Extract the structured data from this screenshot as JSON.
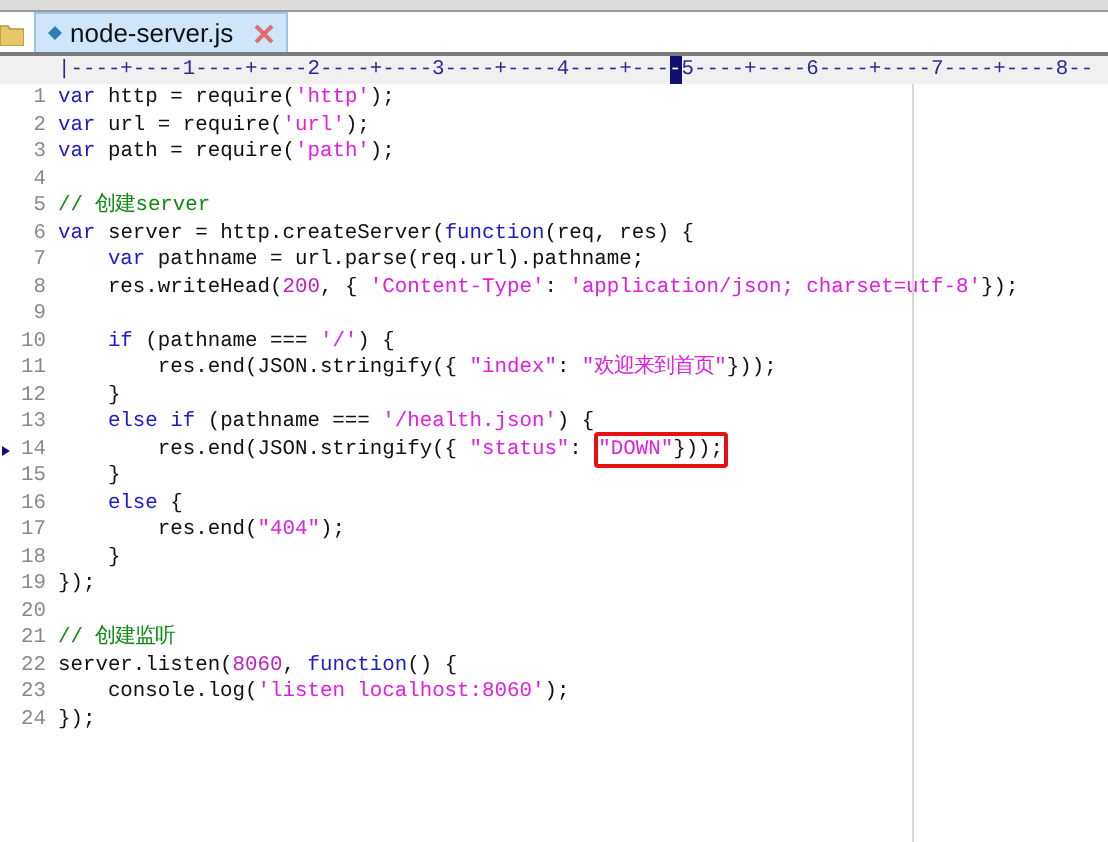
{
  "tabs": [
    {
      "label": "node-server.js",
      "selected": true
    }
  ],
  "ruler": [
    {
      "text": "|----+----1----+----2----+----3----+----4----+---",
      "selected": false
    },
    {
      "text": "-",
      "selected": true
    },
    {
      "text": "5----+----6----+----7----+----8--",
      "selected": false
    }
  ],
  "lines": [
    {
      "number": "1",
      "marked": false,
      "tokens": [
        {
          "kind": "kw",
          "text": "var"
        },
        {
          "kind": "plain",
          "text": " http = require("
        },
        {
          "kind": "str",
          "text": "'http'"
        },
        {
          "kind": "plain",
          "text": ");"
        }
      ]
    },
    {
      "number": "2",
      "marked": false,
      "tokens": [
        {
          "kind": "kw",
          "text": "var"
        },
        {
          "kind": "plain",
          "text": " url = require("
        },
        {
          "kind": "str",
          "text": "'url'"
        },
        {
          "kind": "plain",
          "text": ");"
        }
      ]
    },
    {
      "number": "3",
      "marked": false,
      "tokens": [
        {
          "kind": "kw",
          "text": "var"
        },
        {
          "kind": "plain",
          "text": " path = require("
        },
        {
          "kind": "str",
          "text": "'path'"
        },
        {
          "kind": "plain",
          "text": ");"
        }
      ]
    },
    {
      "number": "4",
      "marked": false
    },
    {
      "number": "5",
      "marked": false,
      "tokens": [
        {
          "kind": "cmt",
          "text": "// 创建server"
        }
      ]
    },
    {
      "number": "6",
      "marked": false,
      "tokens": [
        {
          "kind": "kw",
          "text": "var"
        },
        {
          "kind": "plain",
          "text": " server = http.createServer("
        },
        {
          "kind": "kw",
          "text": "function"
        },
        {
          "kind": "plain",
          "text": "(req, res) {"
        }
      ]
    },
    {
      "number": "7",
      "marked": false,
      "tokens": [
        {
          "kind": "kw",
          "text": "    var"
        },
        {
          "kind": "plain",
          "text": " pathname = url.parse(req.url).pathname;"
        }
      ]
    },
    {
      "number": "8",
      "marked": false,
      "tokens": [
        {
          "kind": "plain",
          "text": "    res.writeHead("
        },
        {
          "kind": "num",
          "text": "200"
        },
        {
          "kind": "plain",
          "text": ", { "
        },
        {
          "kind": "str",
          "text": "'Content-Type'"
        },
        {
          "kind": "plain",
          "text": ": "
        },
        {
          "kind": "str",
          "text": "'application/json; charset=utf-8'"
        },
        {
          "kind": "plain",
          "text": "});"
        }
      ]
    },
    {
      "number": "9",
      "marked": false
    },
    {
      "number": "10",
      "marked": false,
      "tokens": [
        {
          "kind": "kw",
          "text": "    if"
        },
        {
          "kind": "plain",
          "text": " (pathname === "
        },
        {
          "kind": "str",
          "text": "'/'"
        },
        {
          "kind": "plain",
          "text": ") {"
        }
      ]
    },
    {
      "number": "11",
      "marked": false,
      "tokens": [
        {
          "kind": "plain",
          "text": "        res.end(JSON.stringify({ "
        },
        {
          "kind": "str",
          "text": "\"index\""
        },
        {
          "kind": "plain",
          "text": ": "
        },
        {
          "kind": "str",
          "text": "\"欢迎来到首页\""
        },
        {
          "kind": "plain",
          "text": "}));"
        }
      ]
    },
    {
      "number": "12",
      "marked": false,
      "tokens": [
        {
          "kind": "plain",
          "text": "    }"
        }
      ]
    },
    {
      "number": "13",
      "marked": false,
      "tokens": [
        {
          "kind": "kw",
          "text": "    else if"
        },
        {
          "kind": "plain",
          "text": " (pathname === "
        },
        {
          "kind": "str",
          "text": "'/health.json'"
        },
        {
          "kind": "plain",
          "text": ") {"
        }
      ]
    },
    {
      "number": "14",
      "marked": true,
      "tokens": [
        {
          "kind": "plain",
          "text": "        res.end(JSON.stringify({ "
        },
        {
          "kind": "str",
          "text": "\"status\""
        },
        {
          "kind": "plain",
          "text": ": "
        }
      ],
      "highlight": [
        {
          "kind": "str",
          "text": "\"DOWN\""
        },
        {
          "kind": "plain",
          "text": "}));"
        }
      ]
    },
    {
      "number": "15",
      "marked": false,
      "tokens": [
        {
          "kind": "plain",
          "text": "    }"
        }
      ]
    },
    {
      "number": "16",
      "marked": false,
      "tokens": [
        {
          "kind": "kw",
          "text": "    else"
        },
        {
          "kind": "plain",
          "text": " {"
        }
      ]
    },
    {
      "number": "17",
      "marked": false,
      "tokens": [
        {
          "kind": "plain",
          "text": "        res.end("
        },
        {
          "kind": "str",
          "text": "\"404\""
        },
        {
          "kind": "plain",
          "text": ");"
        }
      ]
    },
    {
      "number": "18",
      "marked": false,
      "tokens": [
        {
          "kind": "plain",
          "text": "    }"
        }
      ]
    },
    {
      "number": "19",
      "marked": false,
      "tokens": [
        {
          "kind": "plain",
          "text": "});"
        }
      ]
    },
    {
      "number": "20",
      "marked": false
    },
    {
      "number": "21",
      "marked": false,
      "tokens": [
        {
          "kind": "cmt",
          "text": "// 创建监听"
        }
      ]
    },
    {
      "number": "22",
      "marked": false,
      "tokens": [
        {
          "kind": "plain",
          "text": "server.listen("
        },
        {
          "kind": "num",
          "text": "8060"
        },
        {
          "kind": "plain",
          "text": ", "
        },
        {
          "kind": "kw",
          "text": "function"
        },
        {
          "kind": "plain",
          "text": "() {"
        }
      ]
    },
    {
      "number": "23",
      "marked": false,
      "tokens": [
        {
          "kind": "plain",
          "text": "    console.log("
        },
        {
          "kind": "str",
          "text": "'listen localhost:8060'"
        },
        {
          "kind": "plain",
          "text": ");"
        }
      ]
    },
    {
      "number": "24",
      "marked": false,
      "tokens": [
        {
          "kind": "plain",
          "text": "});"
        }
      ]
    }
  ]
}
